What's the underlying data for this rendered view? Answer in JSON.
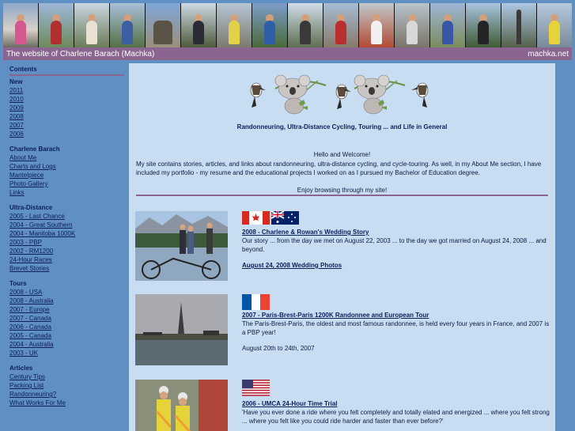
{
  "header": {
    "site_title": "The website of Charlene Barach (Machka)",
    "domain": "machka.net",
    "banner_photos": 16
  },
  "sidebar": {
    "contents_heading": "Contents",
    "new_heading": "New",
    "years": [
      "2011",
      "2010",
      "2009",
      "2008",
      "2007",
      "2006"
    ],
    "sections": [
      {
        "heading": "Charlene Barach",
        "items": [
          "About Me",
          "Charts and Logs",
          "Mantelpiece",
          "Photo Gallery",
          "Links"
        ]
      },
      {
        "heading": "Ultra-Distance",
        "items": [
          "2005 - Last Chance",
          "2004 - Great Southern",
          "2004 - Manitoba 1000K",
          "2003 - PBP",
          "2002 - RM1200",
          "24-Hour Races",
          "Brevet Stories"
        ]
      },
      {
        "heading": "Tours",
        "items": [
          "2008 - USA",
          "2008 - Australia",
          "2007 - Europe",
          "2007 - Canada",
          "2006 - Canada",
          "2005 - Canada",
          "2004 - Australia",
          "2003 - UK"
        ]
      },
      {
        "heading": "Articles",
        "items": [
          "Century Tips",
          "Packing List",
          "Randonneuring?",
          "What Works For Me"
        ]
      }
    ]
  },
  "main": {
    "tagline": "Randonneuring, Ultra-Distance Cycling, Touring ... and Life in General",
    "welcome_title": "Hello and Welcome!",
    "welcome_text": "My site contains stories, articles, and links about randonneuring, ultra-distance cycling, and cycle-touring. As well, in my About Me section, I have included my portfolio - my resume and the educational projects I worked on as I pursued my Bachelor of Education degree.",
    "enjoy": "Enjoy browsing through my site!",
    "entries": [
      {
        "flags": [
          "canada",
          "australia"
        ],
        "title": "2008 - Charlene & Rowan's Wedding Story",
        "desc": "Our story ... from the day we met on August 22, 2003 ... to the day we got married on August 24, 2008 ... and beyond.",
        "extra": "August 24, 2008 Wedding Photos"
      },
      {
        "flags": [
          "france"
        ],
        "title": "2007 - Paris-Brest-Paris 1200K Randonnee and European Tour",
        "desc": "The Paris-Brest-Paris, the oldest and most famous randonnee, is held every four years in France, and 2007 is a PBP year!",
        "extra": "August 20th to 24th, 2007"
      },
      {
        "flags": [
          "usa"
        ],
        "title": "2006 - UMCA 24-Hour Time Trial",
        "desc": "'Have you ever done a ride where you felt completely and totally elated and energized ... where you felt strong ... where you felt like you could ride harder and faster than ever before?'",
        "extra": ""
      }
    ]
  }
}
